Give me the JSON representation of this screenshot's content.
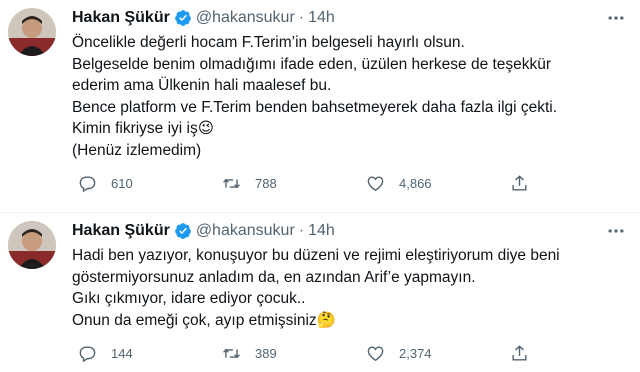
{
  "tweets": [
    {
      "author": {
        "name": "Hakan Şükür",
        "handle": "@hakansukur"
      },
      "separator": "·",
      "time": "14h",
      "lines": [
        "Öncelikle değerli hocam F.Terim’in belgeseli hayırlı olsun.",
        "Belgeselde benim olmadığımı ifade eden, üzülen herkese de teşekkür",
        "ederim ama Ülkenin hali maalesef bu.",
        "Bence platform ve F.Terim benden bahsetmeyerek daha fazla ilgi çekti.",
        "Kimin fikriyse iyi iş😉",
        "(Henüz izlemedim)"
      ],
      "stats": {
        "replies": "610",
        "retweets": "788",
        "likes": "4,866"
      }
    },
    {
      "author": {
        "name": "Hakan Şükür",
        "handle": "@hakansukur"
      },
      "separator": "·",
      "time": "14h",
      "lines": [
        "Hadi ben yazıyor, konuşuyor bu düzeni ve rejimi eleştiriyorum diye beni",
        "göstermiyorsunuz anladım  da, en azından Arif’e yapmayın.",
        "Gıkı çıkmıyor, idare ediyor çocuk..",
        "Onun da emeği çok, ayıp etmişsiniz🤔"
      ],
      "stats": {
        "replies": "144",
        "retweets": "389",
        "likes": "2,374"
      }
    }
  ],
  "icons": {
    "verified": "verified-badge-icon",
    "more": "more-dots-icon",
    "reply": "reply-icon",
    "retweet": "retweet-icon",
    "like": "heart-icon",
    "share": "share-icon"
  },
  "colors": {
    "verified": "#1d9bf0",
    "muted": "#536471",
    "text": "#0f1419"
  }
}
